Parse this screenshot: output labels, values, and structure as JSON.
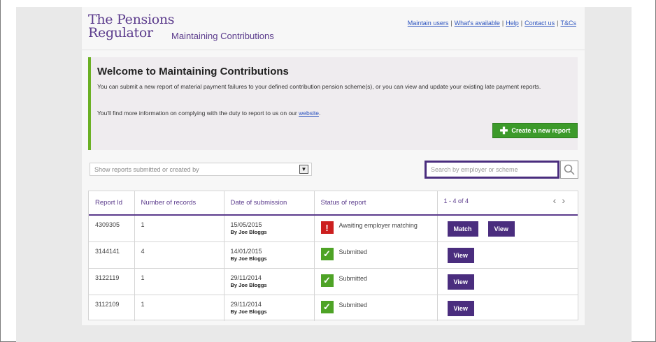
{
  "header": {
    "logo_line1": "The Pensions",
    "logo_line2": "Regulator",
    "app_name": "Maintaining Contributions",
    "links": [
      "Maintain users",
      "What's available",
      "Help",
      "Contact us",
      "T&Cs"
    ]
  },
  "welcome": {
    "title": "Welcome to Maintaining Contributions",
    "para1": "You can submit a new report of material payment failures to your defined contribution pension scheme(s), or you can view and update your existing late payment reports.",
    "para2_prefix": "You'll find more information on complying with the duty to report to us on our ",
    "para2_link": "website",
    "para2_suffix": ".",
    "create_button": "Create a new report"
  },
  "filter": {
    "placeholder": "Show reports submitted or created by"
  },
  "search": {
    "placeholder": "Search by employer or scheme"
  },
  "table": {
    "headers": [
      "Report Id",
      "Number of records",
      "Date of submission",
      "Status of report"
    ],
    "pager": "1 - 4 of 4",
    "rows": [
      {
        "id": "4309305",
        "records": "1",
        "date": "15/05/2015",
        "by": "By Joe Bloggs",
        "status": "Awaiting employer matching",
        "status_type": "warning",
        "actions": [
          "Match",
          "View"
        ]
      },
      {
        "id": "3144141",
        "records": "4",
        "date": "14/01/2015",
        "by": "By Joe Bloggs",
        "status": "Submitted",
        "status_type": "ok",
        "actions": [
          "View"
        ]
      },
      {
        "id": "3122119",
        "records": "1",
        "date": "29/11/2014",
        "by": "By Joe Bloggs",
        "status": "Submitted",
        "status_type": "ok",
        "actions": [
          "View"
        ]
      },
      {
        "id": "3112109",
        "records": "1",
        "date": "29/11/2014",
        "by": "By Joe Bloggs",
        "status": "Submitted",
        "status_type": "ok",
        "actions": [
          "View"
        ]
      }
    ]
  },
  "colors": {
    "brand_purple": "#5b3b8c",
    "button_purple": "#4a2d7e",
    "accent_green": "#6bb024",
    "success_green": "#4ea326",
    "warning_red": "#cc1f1f"
  }
}
